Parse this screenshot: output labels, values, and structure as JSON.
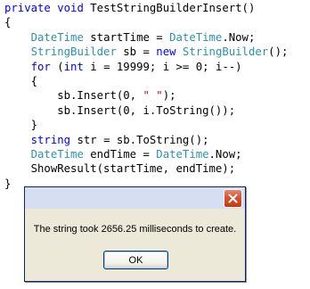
{
  "code": {
    "lines": [
      {
        "spans": [
          {
            "t": "private ",
            "c": "kw"
          },
          {
            "t": "void ",
            "c": "kw"
          },
          {
            "t": "TestStringBuilderInsert()",
            "c": ""
          }
        ]
      },
      {
        "spans": [
          {
            "t": "{",
            "c": ""
          }
        ]
      },
      {
        "spans": [
          {
            "t": "    ",
            "c": ""
          },
          {
            "t": "DateTime",
            "c": "ty"
          },
          {
            "t": " startTime = ",
            "c": ""
          },
          {
            "t": "DateTime",
            "c": "ty"
          },
          {
            "t": ".Now;",
            "c": ""
          }
        ]
      },
      {
        "spans": [
          {
            "t": "    ",
            "c": ""
          },
          {
            "t": "StringBuilder",
            "c": "ty"
          },
          {
            "t": " sb = ",
            "c": ""
          },
          {
            "t": "new ",
            "c": "kw"
          },
          {
            "t": "StringBuilder",
            "c": "ty"
          },
          {
            "t": "();",
            "c": ""
          }
        ]
      },
      {
        "spans": [
          {
            "t": "    ",
            "c": ""
          },
          {
            "t": "for ",
            "c": "kw"
          },
          {
            "t": "(",
            "c": ""
          },
          {
            "t": "int",
            "c": "kw"
          },
          {
            "t": " i = 19999; i >= 0; i--)",
            "c": ""
          }
        ]
      },
      {
        "spans": [
          {
            "t": "    {",
            "c": ""
          }
        ]
      },
      {
        "spans": [
          {
            "t": "        sb.Insert(0, ",
            "c": ""
          },
          {
            "t": "\" \"",
            "c": "str"
          },
          {
            "t": ");",
            "c": ""
          }
        ]
      },
      {
        "spans": [
          {
            "t": "        sb.Insert(0, i.ToString());",
            "c": ""
          }
        ]
      },
      {
        "spans": [
          {
            "t": "    }",
            "c": ""
          }
        ]
      },
      {
        "spans": [
          {
            "t": "    ",
            "c": ""
          },
          {
            "t": "string",
            "c": "kw"
          },
          {
            "t": " str = sb.ToString();",
            "c": ""
          }
        ]
      },
      {
        "spans": [
          {
            "t": "    ",
            "c": ""
          },
          {
            "t": "DateTime",
            "c": "ty"
          },
          {
            "t": " endTime = ",
            "c": ""
          },
          {
            "t": "DateTime",
            "c": "ty"
          },
          {
            "t": ".Now;",
            "c": ""
          }
        ]
      },
      {
        "spans": [
          {
            "t": "    ShowResult(startTime, endTime);",
            "c": ""
          }
        ]
      },
      {
        "spans": [
          {
            "t": "}",
            "c": ""
          }
        ]
      }
    ]
  },
  "dialog": {
    "message": "The string took 2656.25 milliseconds to create.",
    "ok_label": "OK",
    "close_icon": "close-icon"
  },
  "colors": {
    "keyword": "#0000ff",
    "type": "#2b91af",
    "string": "#a31515",
    "dialog_face": "#ece9d8",
    "close_button": "#d5542e"
  }
}
